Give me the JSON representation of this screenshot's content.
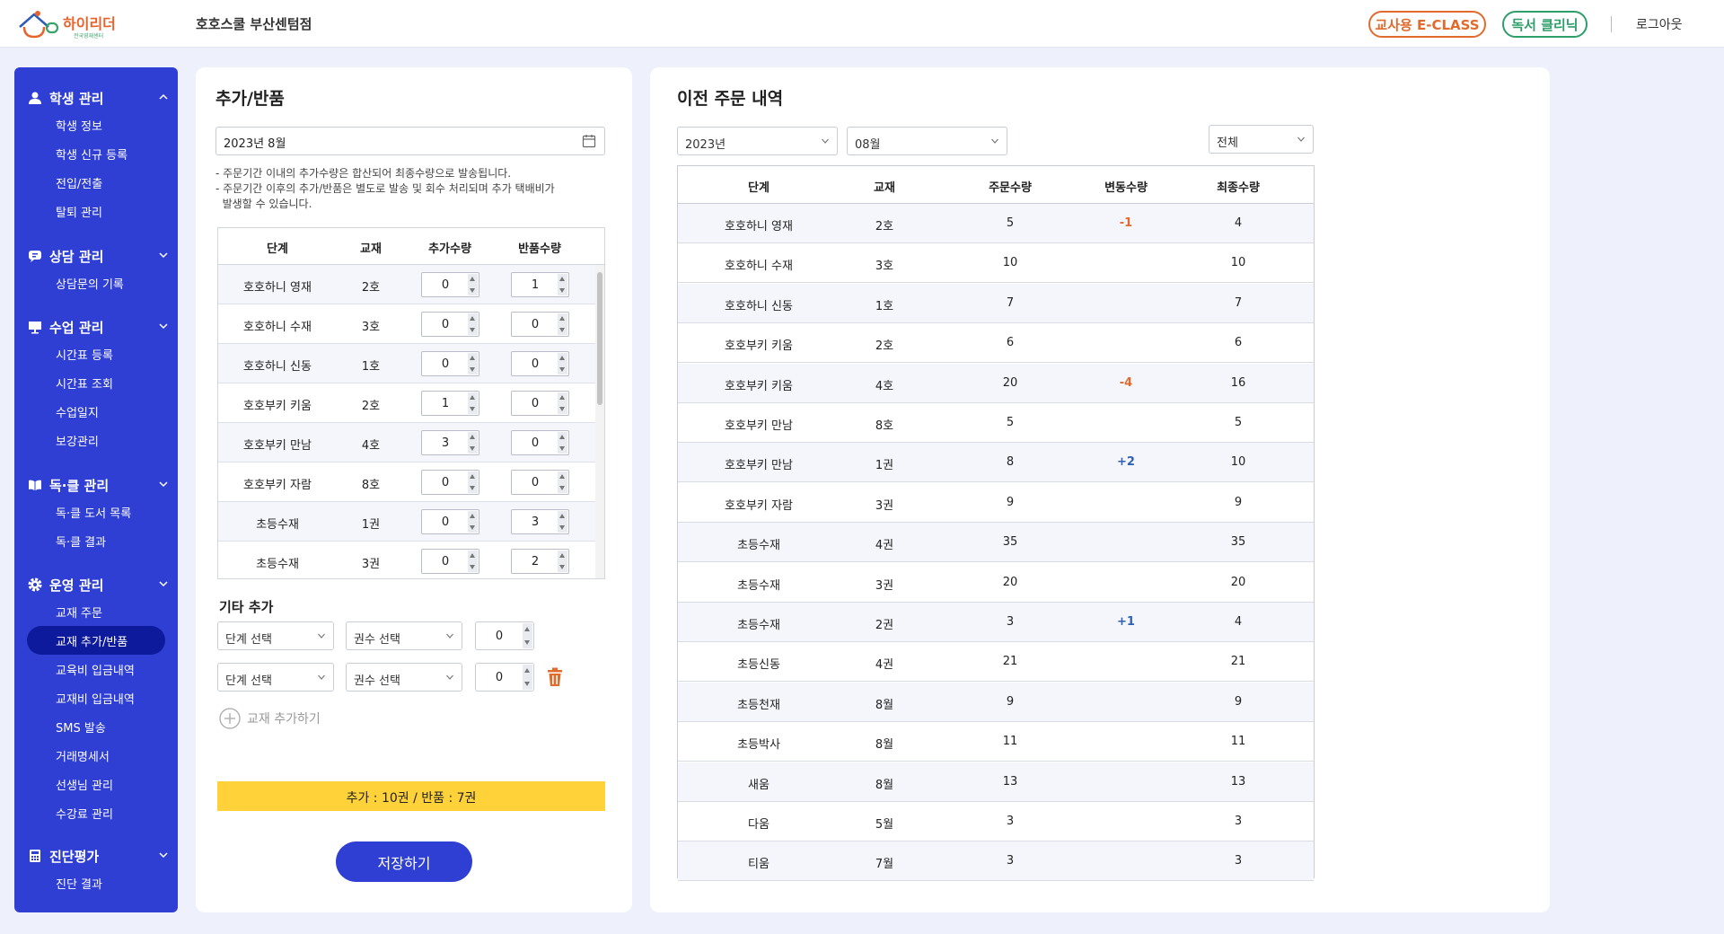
{
  "header": {
    "logo_text": "하이리더",
    "logo_sub": "전국영재센터",
    "center_name": "호호스쿨 부산센텀점",
    "eclass_label": "교사용 E-CLASS",
    "reading_label": "독서 클리닉",
    "logout_label": "로그아웃"
  },
  "colors": {
    "primary": "#2f3fd3",
    "active": "#0e1a9c",
    "accent_orange": "#e06b2c",
    "accent_green": "#2e9e6b",
    "summary_bg": "#ffd23a"
  },
  "sidebar": {
    "sections": [
      {
        "title": "학생 관리",
        "icon": "person-icon",
        "items": [
          "학생 정보",
          "학생 신규 등록",
          "전입/전출",
          "탈퇴 관리"
        ]
      },
      {
        "title": "상담 관리",
        "icon": "chat-icon",
        "items": [
          "상담문의 기록"
        ]
      },
      {
        "title": "수업 관리",
        "icon": "board-icon",
        "items": [
          "시간표 등록",
          "시간표 조회",
          "수업일지",
          "보강관리"
        ]
      },
      {
        "title": "독·클 관리",
        "icon": "book-icon",
        "items": [
          "독·클 도서 목록",
          "독·클 결과"
        ]
      },
      {
        "title": "운영 관리",
        "icon": "gear-icon",
        "items": [
          "교재 주문",
          "교재 추가/반품",
          "교육비 입금내역",
          "교재비 입금내역",
          "SMS 발송",
          "거래명세서",
          "선생님 관리",
          "수강료 관리"
        ]
      },
      {
        "title": "진단평가",
        "icon": "calculator-icon",
        "items": [
          "진단 결과"
        ]
      }
    ],
    "active_item": "교재 추가/반품"
  },
  "left_panel": {
    "title": "추가/반품",
    "date_value": "2023년 8월",
    "notice_1": "- 주문기간 이내의 추가수량은 합산되어 최종수량으로 발송됩니다.",
    "notice_2": "- 주문기간 이후의 추가/반품은 별도로 발송 및 회수 처리되며 추가 택배비가",
    "notice_3": "  발생할 수 있습니다.",
    "columns": [
      "단계",
      "교재",
      "추가수량",
      "반품수량"
    ],
    "rows": [
      {
        "step": "호호하니 영재",
        "book": "2호",
        "add": "0",
        "ret": "1"
      },
      {
        "step": "호호하니 수재",
        "book": "3호",
        "add": "0",
        "ret": "0"
      },
      {
        "step": "호호하니 신동",
        "book": "1호",
        "add": "0",
        "ret": "0"
      },
      {
        "step": "호호부키 키움",
        "book": "2호",
        "add": "1",
        "ret": "0"
      },
      {
        "step": "호호부키 만남",
        "book": "4호",
        "add": "3",
        "ret": "0"
      },
      {
        "step": "호호부키 자람",
        "book": "8호",
        "add": "0",
        "ret": "0"
      },
      {
        "step": "초등수재",
        "book": "1권",
        "add": "0",
        "ret": "3"
      },
      {
        "step": "초등수재",
        "book": "3권",
        "add": "0",
        "ret": "2"
      }
    ],
    "etc_title": "기타 추가",
    "etc_rows": [
      {
        "step_placeholder": "단계 선택",
        "vol_placeholder": "권수 선택",
        "qty": "0"
      },
      {
        "step_placeholder": "단계 선택",
        "vol_placeholder": "권수 선택",
        "qty": "0"
      }
    ],
    "add_book_label": "교재 추가하기",
    "summary": "추가 : 10권 / 반품 : 7권",
    "save_label": "저장하기"
  },
  "right_panel": {
    "title": "이전 주문 내역",
    "year_value": "2023년",
    "month_value": "08월",
    "filter_value": "전체",
    "columns": [
      "단계",
      "교재",
      "주문수량",
      "변동수량",
      "최종수량"
    ],
    "rows": [
      {
        "step": "호호하니 영재",
        "book": "2호",
        "order": "5",
        "change": "-1",
        "final": "4"
      },
      {
        "step": "호호하니 수재",
        "book": "3호",
        "order": "10",
        "change": "",
        "final": "10"
      },
      {
        "step": "호호하니 신동",
        "book": "1호",
        "order": "7",
        "change": "",
        "final": "7"
      },
      {
        "step": "호호부키 키움",
        "book": "2호",
        "order": "6",
        "change": "",
        "final": "6"
      },
      {
        "step": "호호부키 키움",
        "book": "4호",
        "order": "20",
        "change": "-4",
        "final": "16"
      },
      {
        "step": "호호부키 만남",
        "book": "8호",
        "order": "5",
        "change": "",
        "final": "5"
      },
      {
        "step": "호호부키 만남",
        "book": "1권",
        "order": "8",
        "change": "+2",
        "final": "10"
      },
      {
        "step": "호호부키 자람",
        "book": "3권",
        "order": "9",
        "change": "",
        "final": "9"
      },
      {
        "step": "초등수재",
        "book": "4권",
        "order": "35",
        "change": "",
        "final": "35"
      },
      {
        "step": "초등수재",
        "book": "3권",
        "order": "20",
        "change": "",
        "final": "20"
      },
      {
        "step": "초등수재",
        "book": "2권",
        "order": "3",
        "change": "+1",
        "final": "4"
      },
      {
        "step": "초등신동",
        "book": "4권",
        "order": "21",
        "change": "",
        "final": "21"
      },
      {
        "step": "초등천재",
        "book": "8월",
        "order": "9",
        "change": "",
        "final": "9"
      },
      {
        "step": "초등박사",
        "book": "8월",
        "order": "11",
        "change": "",
        "final": "11"
      },
      {
        "step": "새움",
        "book": "8월",
        "order": "13",
        "change": "",
        "final": "13"
      },
      {
        "step": "다움",
        "book": "5월",
        "order": "3",
        "change": "",
        "final": "3"
      },
      {
        "step": "티움",
        "book": "7월",
        "order": "3",
        "change": "",
        "final": "3"
      }
    ]
  }
}
